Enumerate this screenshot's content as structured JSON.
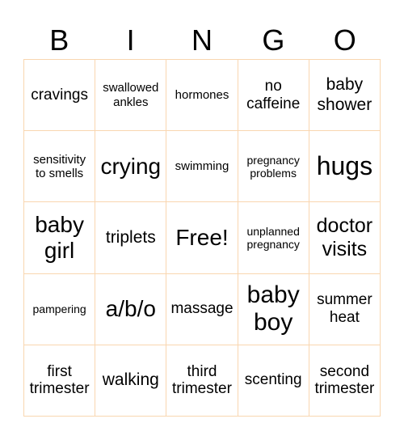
{
  "header": {
    "letters": [
      "B",
      "I",
      "N",
      "G",
      "O"
    ]
  },
  "board": {
    "border_color": "#f9d6b0",
    "rows": [
      [
        "cravings",
        "swallowed ankles",
        "hormones",
        "no caffeine",
        "baby shower"
      ],
      [
        "sensitivity to smells",
        "crying",
        "swimming",
        "pregnancy problems",
        "hugs"
      ],
      [
        "baby girl",
        "triplets",
        "Free!",
        "unplanned pregnancy",
        "doctor visits"
      ],
      [
        "pampering",
        "a/b/o",
        "massage",
        "baby boy",
        "summer heat"
      ],
      [
        "first trimester",
        "walking",
        "third trimester",
        "scenting",
        "second trimester"
      ]
    ]
  }
}
